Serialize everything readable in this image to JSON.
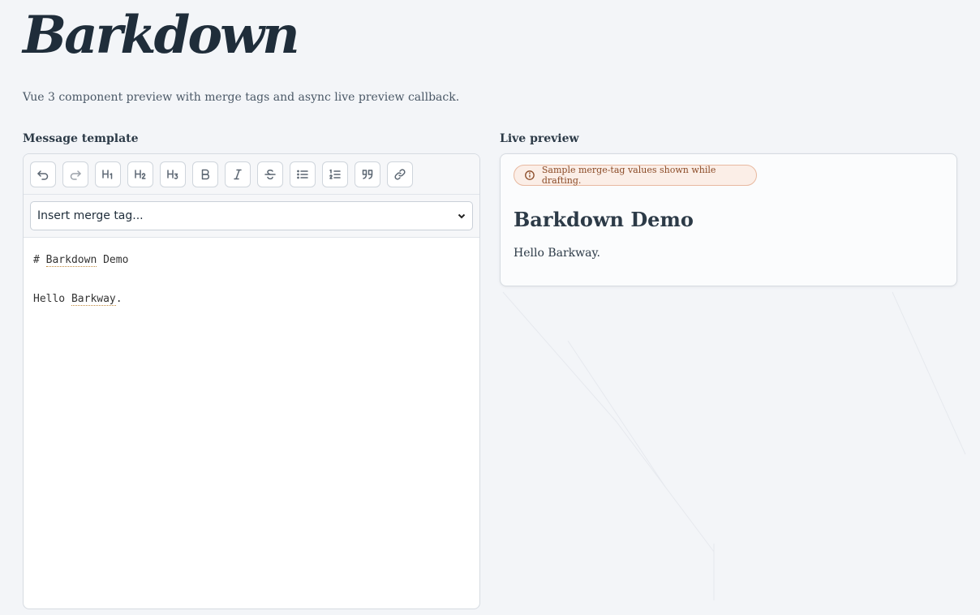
{
  "app": {
    "logo": "Barkdown",
    "subtitle": "Vue 3 component preview with merge tags and async live preview callback."
  },
  "editor": {
    "label": "Message template",
    "toolbar": [
      {
        "name": "undo-button",
        "icon": "undo-icon"
      },
      {
        "name": "redo-button",
        "icon": "redo-icon"
      },
      {
        "name": "heading-1-button",
        "icon": "h1-icon"
      },
      {
        "name": "heading-2-button",
        "icon": "h2-icon"
      },
      {
        "name": "heading-3-button",
        "icon": "h3-icon"
      },
      {
        "name": "bold-button",
        "icon": "bold-icon"
      },
      {
        "name": "italic-button",
        "icon": "italic-icon"
      },
      {
        "name": "strikethrough-button",
        "icon": "strikethrough-icon"
      },
      {
        "name": "bullet-list-button",
        "icon": "bullet-list-icon"
      },
      {
        "name": "ordered-list-button",
        "icon": "ordered-list-icon"
      },
      {
        "name": "blockquote-button",
        "icon": "quote-icon"
      },
      {
        "name": "link-button",
        "icon": "link-icon"
      }
    ],
    "merge_select": {
      "value": "Insert merge tag..."
    },
    "lines": {
      "l1_prefix": "# ",
      "l1_tag": "Barkdown",
      "l1_suffix": " Demo",
      "l2_prefix": "Hello ",
      "l2_tag": "Barkway",
      "l2_suffix": "."
    }
  },
  "preview": {
    "label": "Live preview",
    "badge": "Sample merge-tag values shown while drafting.",
    "title": "Barkdown Demo",
    "body": "Hello Barkway."
  },
  "colors": {
    "background": "#f3f5f8",
    "badge_bg": "#fbeee7",
    "badge_text": "#8a4a26",
    "text": "#1f2d3a"
  }
}
